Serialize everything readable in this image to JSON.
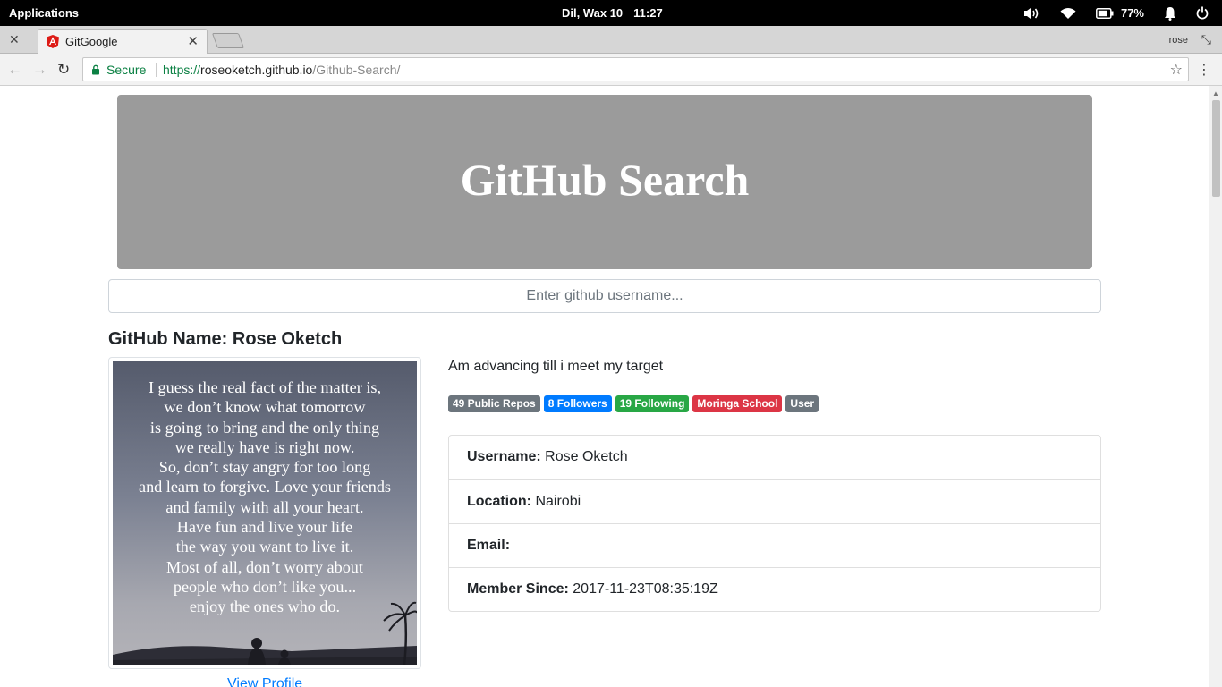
{
  "system_bar": {
    "applications": "Applications",
    "date": "Dil, Wax 10",
    "time": "11:27",
    "battery_percent": "77%"
  },
  "browser": {
    "tab_title": "GitGoogle",
    "profile_name": "rose",
    "secure_label": "Secure",
    "url_scheme": "https://",
    "url_host": "roseoketch.github.io",
    "url_path": "/Github-Search/"
  },
  "page": {
    "heading": "GitHub Search",
    "search_placeholder": "Enter github username...",
    "github_name": "GitHub Name: Rose Oketch",
    "bio": "Am advancing till i meet my target",
    "badges": [
      {
        "label": "49 Public Repos",
        "color": "#6c757d"
      },
      {
        "label": "8 Followers",
        "color": "#007bff"
      },
      {
        "label": "19 Following",
        "color": "#28a745"
      },
      {
        "label": "Moringa School",
        "color": "#dc3545"
      },
      {
        "label": "User",
        "color": "#6c757d"
      }
    ],
    "details": [
      {
        "label": "Username:",
        "value": "Rose Oketch"
      },
      {
        "label": "Location:",
        "value": "Nairobi"
      },
      {
        "label": "Email:",
        "value": ""
      },
      {
        "label": "Member Since:",
        "value": "2017-11-23T08:35:19Z"
      }
    ],
    "avatar_quote": [
      "I guess the real fact of the matter is,",
      "we don’t know what tomorrow",
      "is going to bring and the only thing",
      "we really have is right now.",
      "So, don’t stay angry for too long",
      "and learn to forgive. Love your friends",
      "and family with all your heart.",
      "Have fun and live your life",
      "the way you want to live it.",
      "Most of all, don’t worry about",
      "people who don’t like you...",
      "enjoy the ones who do."
    ],
    "view_profile": "View Profile"
  },
  "colors": {
    "jumbotron": "#9b9b9b",
    "link": "#007bff",
    "secure_green": "#0b8043"
  }
}
